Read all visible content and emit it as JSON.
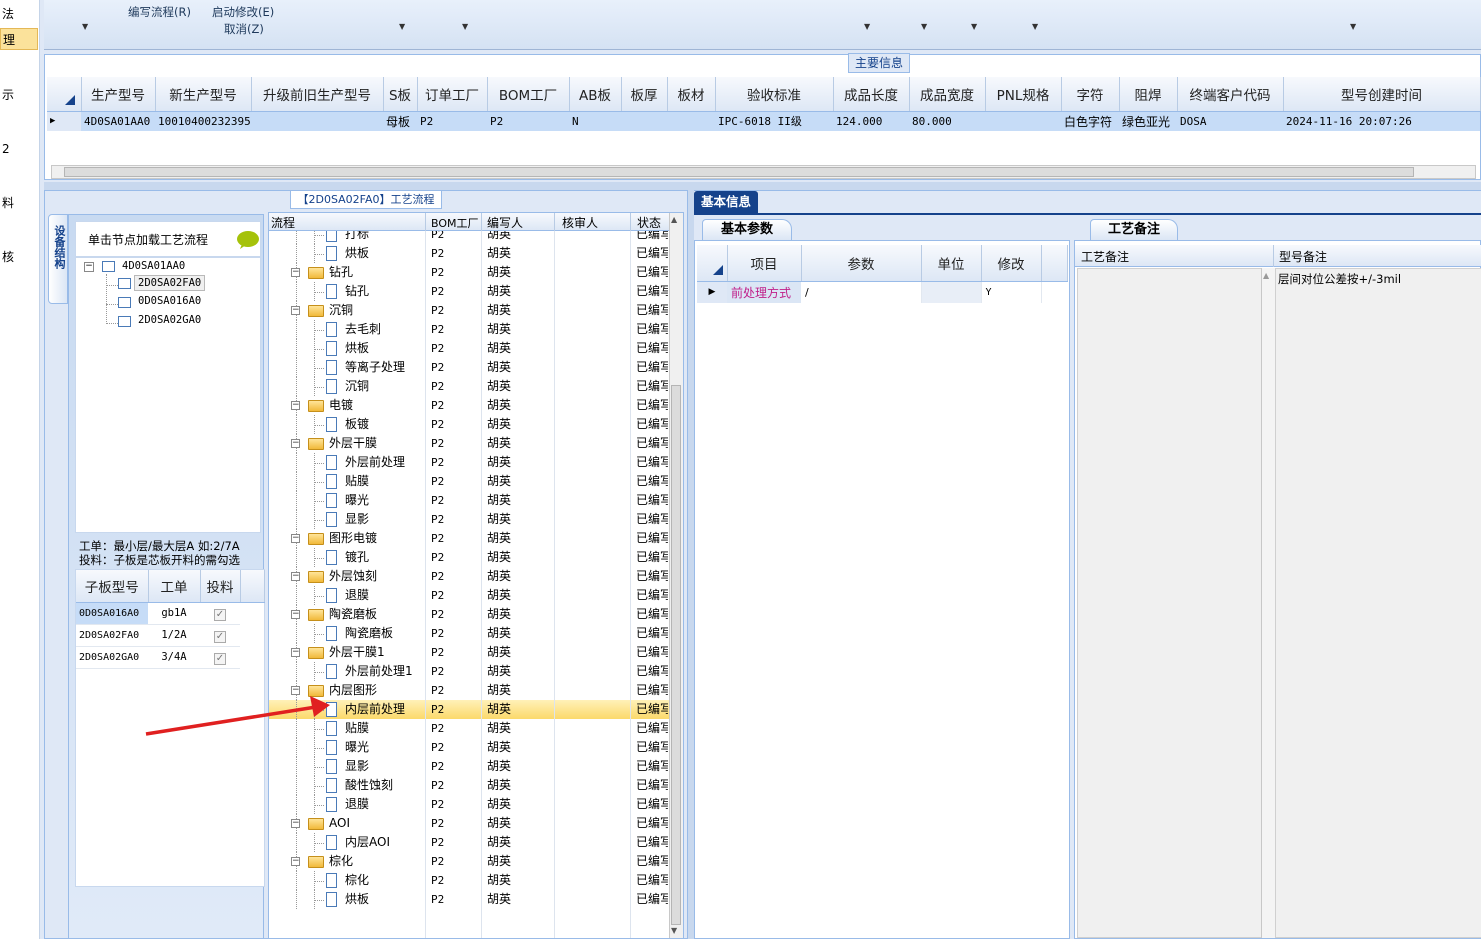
{
  "left_nav": {
    "items": [
      {
        "label": "法"
      },
      {
        "label": "理"
      },
      {
        "label": "示"
      },
      {
        "label": "2"
      },
      {
        "label": "料"
      },
      {
        "label": "核"
      }
    ]
  },
  "toolbar": {
    "items": [
      {
        "label": "编写流程(R)"
      },
      {
        "label": "启动修改(E)"
      },
      {
        "label": "取消(Z)"
      }
    ]
  },
  "main_info": {
    "title": "主要信息",
    "columns": [
      "生产型号",
      "新生产型号",
      "升级前旧生产型号",
      "S板",
      "订单工厂",
      "BOM工厂",
      "AB板",
      "板厚",
      "板材",
      "验收标准",
      "成品长度",
      "成品宽度",
      "PNL规格",
      "字符",
      "阻焊",
      "终端客户代码",
      "型号创建时间"
    ],
    "row": [
      "4D0SA01AA0",
      "10010400232395",
      "",
      "母板",
      "P2",
      "P2",
      "N",
      "",
      "",
      "IPC-6018 II级",
      "124.000",
      "80.000",
      "",
      "白色字符",
      "绿色亚光",
      "DOSA",
      "2024-11-16 20:07:26"
    ]
  },
  "process_panel": {
    "title": "【2D0SA02FA0】工艺流程",
    "side_tab": "设备结构",
    "hint": "单击节点加载工艺流程",
    "tree": {
      "root": "4D0SA01AA0",
      "children": [
        "2D0SA02FA0",
        "0D0SA016A0",
        "2D0SA02GA0"
      ]
    },
    "note_line1": "工单：最小层/最大层A 如:2/7A",
    "note_line2": "投料：子板是芯板开料的需勾选",
    "sub_table": {
      "columns": [
        "子板型号",
        "工单",
        "投料"
      ],
      "rows": [
        {
          "model": "0D0SA016A0",
          "order": "gb1A",
          "feed": "✓"
        },
        {
          "model": "2D0SA02FA0",
          "order": "1/2A",
          "feed": "✓"
        },
        {
          "model": "2D0SA02GA0",
          "order": "3/4A",
          "feed": "✓"
        }
      ]
    }
  },
  "flow_grid": {
    "columns": [
      "流程",
      "BOM工厂",
      "编写人",
      "核审人",
      "状态"
    ],
    "rows": [
      {
        "type": "doc",
        "name": "打标",
        "bom": "P2",
        "writer": "胡英",
        "status": "已编写"
      },
      {
        "type": "doc",
        "name": "烘板",
        "bom": "P2",
        "writer": "胡英",
        "status": "已编写"
      },
      {
        "type": "folder",
        "name": "钻孔",
        "bom": "P2",
        "writer": "胡英",
        "status": "已编写"
      },
      {
        "type": "doc",
        "name": "钻孔",
        "bom": "P2",
        "writer": "胡英",
        "status": "已编写"
      },
      {
        "type": "folder",
        "name": "沉铜",
        "bom": "P2",
        "writer": "胡英",
        "status": "已编写"
      },
      {
        "type": "doc",
        "name": "去毛刺",
        "bom": "P2",
        "writer": "胡英",
        "status": "已编写"
      },
      {
        "type": "doc",
        "name": "烘板",
        "bom": "P2",
        "writer": "胡英",
        "status": "已编写"
      },
      {
        "type": "doc",
        "name": "等离子处理",
        "bom": "P2",
        "writer": "胡英",
        "status": "已编写"
      },
      {
        "type": "doc",
        "name": "沉铜",
        "bom": "P2",
        "writer": "胡英",
        "status": "已编写"
      },
      {
        "type": "folder",
        "name": "电镀",
        "bom": "P2",
        "writer": "胡英",
        "status": "已编写"
      },
      {
        "type": "doc",
        "name": "板镀",
        "bom": "P2",
        "writer": "胡英",
        "status": "已编写"
      },
      {
        "type": "folder",
        "name": "外层干膜",
        "bom": "P2",
        "writer": "胡英",
        "status": "已编写"
      },
      {
        "type": "doc",
        "name": "外层前处理",
        "bom": "P2",
        "writer": "胡英",
        "status": "已编写"
      },
      {
        "type": "doc",
        "name": "贴膜",
        "bom": "P2",
        "writer": "胡英",
        "status": "已编写"
      },
      {
        "type": "doc",
        "name": "曝光",
        "bom": "P2",
        "writer": "胡英",
        "status": "已编写"
      },
      {
        "type": "doc",
        "name": "显影",
        "bom": "P2",
        "writer": "胡英",
        "status": "已编写"
      },
      {
        "type": "folder",
        "name": "图形电镀",
        "bom": "P2",
        "writer": "胡英",
        "status": "已编写"
      },
      {
        "type": "doc",
        "name": "镀孔",
        "bom": "P2",
        "writer": "胡英",
        "status": "已编写"
      },
      {
        "type": "folder",
        "name": "外层蚀刻",
        "bom": "P2",
        "writer": "胡英",
        "status": "已编写"
      },
      {
        "type": "doc",
        "name": "退膜",
        "bom": "P2",
        "writer": "胡英",
        "status": "已编写"
      },
      {
        "type": "folder",
        "name": "陶瓷磨板",
        "bom": "P2",
        "writer": "胡英",
        "status": "已编写"
      },
      {
        "type": "doc",
        "name": "陶瓷磨板",
        "bom": "P2",
        "writer": "胡英",
        "status": "已编写"
      },
      {
        "type": "folder",
        "name": "外层干膜1",
        "bom": "P2",
        "writer": "胡英",
        "status": "已编写"
      },
      {
        "type": "doc",
        "name": "外层前处理1",
        "bom": "P2",
        "writer": "胡英",
        "status": "已编写"
      },
      {
        "type": "folder",
        "name": "内层图形",
        "bom": "P2",
        "writer": "胡英",
        "status": "已编写"
      },
      {
        "type": "doc",
        "name": "内层前处理",
        "bom": "P2",
        "writer": "胡英",
        "status": "已编写",
        "selected": true
      },
      {
        "type": "doc",
        "name": "贴膜",
        "bom": "P2",
        "writer": "胡英",
        "status": "已编写"
      },
      {
        "type": "doc",
        "name": "曝光",
        "bom": "P2",
        "writer": "胡英",
        "status": "已编写"
      },
      {
        "type": "doc",
        "name": "显影",
        "bom": "P2",
        "writer": "胡英",
        "status": "已编写"
      },
      {
        "type": "doc",
        "name": "酸性蚀刻",
        "bom": "P2",
        "writer": "胡英",
        "status": "已编写"
      },
      {
        "type": "doc",
        "name": "退膜",
        "bom": "P2",
        "writer": "胡英",
        "status": "已编写"
      },
      {
        "type": "folder",
        "name": "AOI",
        "bom": "P2",
        "writer": "胡英",
        "status": "已编写"
      },
      {
        "type": "doc",
        "name": "内层AOI",
        "bom": "P2",
        "writer": "胡英",
        "status": "已编写"
      },
      {
        "type": "folder",
        "name": "棕化",
        "bom": "P2",
        "writer": "胡英",
        "status": "已编写"
      },
      {
        "type": "doc",
        "name": "棕化",
        "bom": "P2",
        "writer": "胡英",
        "status": "已编写"
      },
      {
        "type": "doc",
        "name": "烘板",
        "bom": "P2",
        "writer": "胡英",
        "status": "已编写"
      }
    ]
  },
  "basic_info": {
    "tab": "基本信息",
    "params_tab": "基本参数",
    "columns": [
      "项目",
      "参数",
      "单位",
      "修改"
    ],
    "rows": [
      {
        "item": "前处理方式",
        "param": "/",
        "unit": "",
        "modify": "Y"
      }
    ]
  },
  "process_notes": {
    "tab": "工艺备注",
    "col1": "工艺备注",
    "col2": "型号备注",
    "model_note": "层间对位公差按+/-3mil"
  },
  "colors": {
    "selection": "#fbd96b",
    "header_blue": "#15428b",
    "row_blue": "#c6dcf7",
    "arrow_red": "#e02020",
    "param_pink": "#c0208a"
  }
}
